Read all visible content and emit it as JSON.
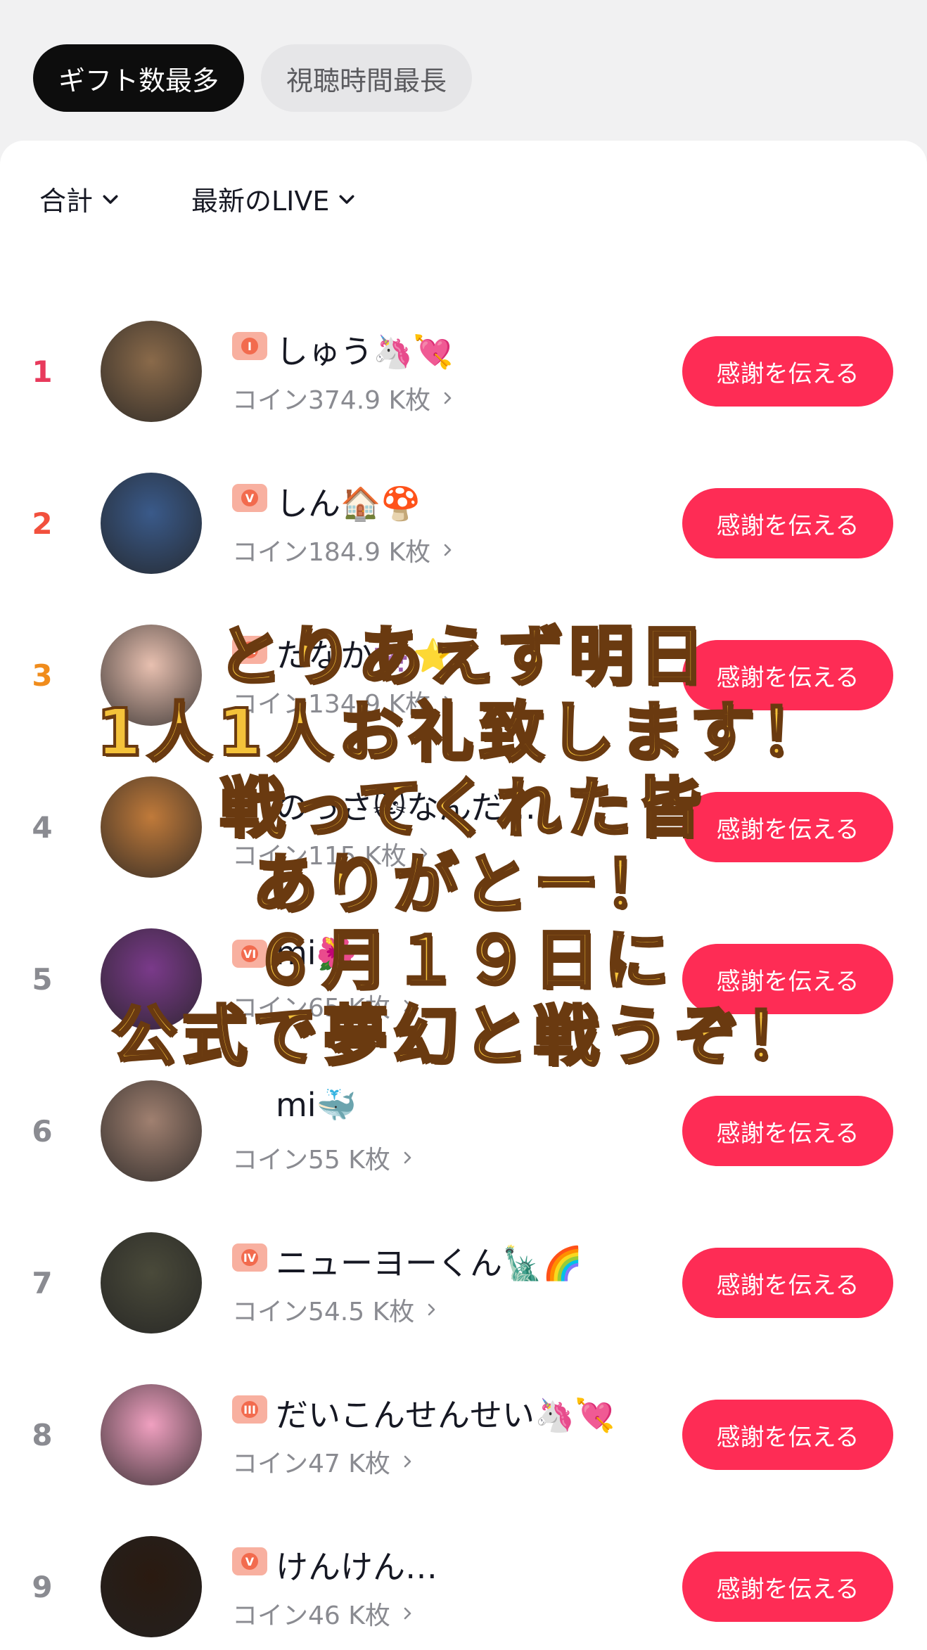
{
  "tabs": [
    {
      "label": "ギフト数最多",
      "active": true
    },
    {
      "label": "視聴時間最長",
      "active": false
    }
  ],
  "filters": [
    {
      "label": "合計"
    },
    {
      "label": "最新のLIVE"
    }
  ],
  "rows": [
    {
      "rank": "1",
      "badge": "I",
      "name": "しゅう🦄💘",
      "coins": "コイン374.9 K枚",
      "button": "感謝を伝える",
      "avatar_color": "#8a6a4a"
    },
    {
      "rank": "2",
      "badge": "V",
      "name": "しん🏠🍄",
      "coins": "コイン184.9 K枚",
      "button": "感謝を伝える",
      "avatar_color": "#3a5a8a"
    },
    {
      "rank": "3",
      "badge": "VI",
      "name": "たなか👾⭐",
      "coins": "コイン134.9 K枚",
      "button": "感謝を伝える",
      "avatar_color": "#e8c0b0"
    },
    {
      "rank": "4",
      "badge": "",
      "name": "のっさ🐱なんだ…",
      "coins": "コイン115 K枚",
      "button": "感謝を伝える",
      "avatar_color": "#c07a3a"
    },
    {
      "rank": "5",
      "badge": "VI",
      "name": "mi🌺",
      "coins": "コイン65 K枚",
      "button": "感謝を伝える",
      "avatar_color": "#7a3a8a"
    },
    {
      "rank": "6",
      "badge": "",
      "name": "mi🐳",
      "coins": "コイン55 K枚",
      "button": "感謝を伝える",
      "avatar_color": "#a08070"
    },
    {
      "rank": "7",
      "badge": "IV",
      "name": "ニューヨーくん🗽🌈",
      "coins": "コイン54.5 K枚",
      "button": "感謝を伝える",
      "avatar_color": "#4a4a3a"
    },
    {
      "rank": "8",
      "badge": "III",
      "name": "だいこんせんせい🦄💘",
      "coins": "コイン47 K枚",
      "button": "感謝を伝える",
      "avatar_color": "#f0a0c0"
    },
    {
      "rank": "9",
      "badge": "V",
      "name": "けんけん…",
      "coins": "コイン46 K枚",
      "button": "感謝を伝える",
      "avatar_color": "#2a1a10"
    }
  ],
  "overlay": {
    "lines": [
      "とりあえず明日",
      "1人1人お礼致します！",
      "戦ってくれた皆",
      "ありがとー！",
      "６月１９日に",
      "公式で夢幻と戦うぞ！"
    ]
  }
}
